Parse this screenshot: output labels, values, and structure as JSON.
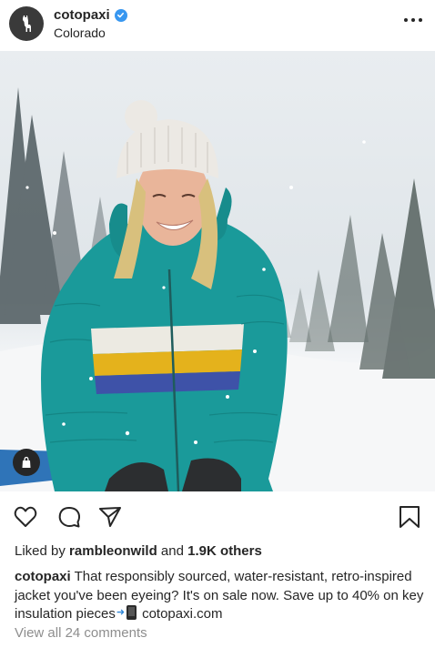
{
  "post": {
    "username": "cotopaxi",
    "location": "Colorado",
    "verified": true,
    "likes_prefix": "Liked by",
    "liked_by_user": "rambleonwild",
    "likes_and": "and",
    "likes_others": "1.9K others",
    "caption_user": "cotopaxi",
    "caption_text": "That responsibly sourced, water-resistant, retro-inspired jacket you've been eyeing? It's on sale now. Save up to 40% on key insulation pieces",
    "caption_link": "cotopaxi.com",
    "view_comments": "View all 24 comments"
  },
  "icons": {
    "avatar": "llama-logo-icon",
    "verified": "verified-badge-icon",
    "more": "more-dots-icon",
    "like": "heart-icon",
    "comment": "comment-bubble-icon",
    "share": "paper-plane-icon",
    "save": "bookmark-icon",
    "shop": "shopping-bag-icon",
    "phone": "mobile-phone-icon"
  },
  "colors": {
    "text": "#262626",
    "muted": "#8e8e8e",
    "verified": "#3897f0",
    "jacket_teal": "#1a9a9a",
    "stripe_white": "#eceae2",
    "stripe_yellow": "#e4b21c",
    "stripe_blue": "#3e52a8"
  }
}
